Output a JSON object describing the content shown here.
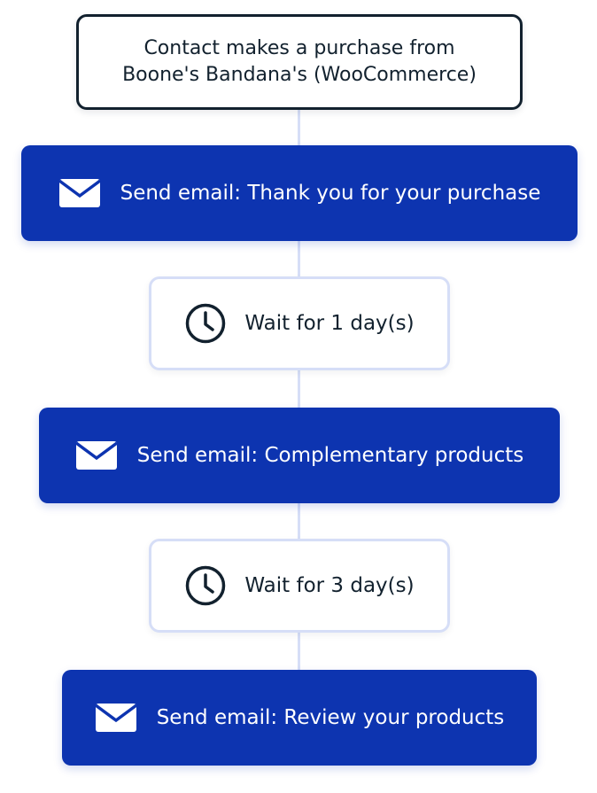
{
  "trigger": {
    "line1": "Contact makes a purchase from",
    "line2": "Boone's Bandana's (WooCommerce)"
  },
  "steps": [
    {
      "type": "email",
      "label": "Send email: Thank you for your purchase",
      "icon": "envelope-icon"
    },
    {
      "type": "wait",
      "label": "Wait for 1 day(s)",
      "icon": "clock-icon"
    },
    {
      "type": "email",
      "label": "Send email: Complementary products",
      "icon": "envelope-icon"
    },
    {
      "type": "wait",
      "label": "Wait for 3 day(s)",
      "icon": "clock-icon"
    },
    {
      "type": "email",
      "label": "Send email: Review your products",
      "icon": "envelope-icon"
    }
  ],
  "colors": {
    "email_bg": "#0d34b0",
    "text_dark": "#12212e",
    "connector": "#d6def7"
  }
}
